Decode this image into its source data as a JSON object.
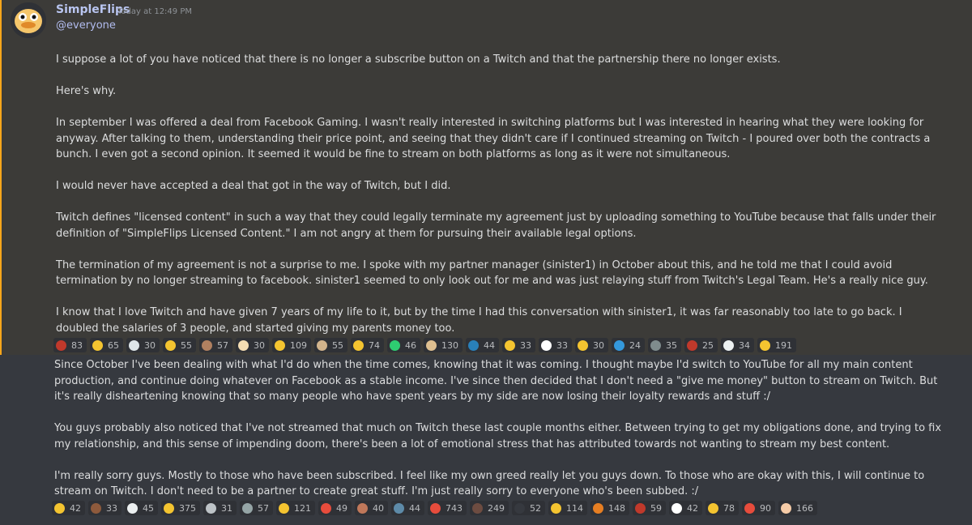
{
  "message": {
    "author": "SimpleFlips",
    "timestamp": "Today at 12:49 PM",
    "mention": "@everyone",
    "paragraphs_part1": [
      "I suppose a lot of you have noticed that there is no longer a subscribe button on a Twitch and that the partnership there no longer exists.",
      "Here's why.",
      "In september I was offered a deal from Facebook Gaming. I wasn't really interested in switching platforms but I was interested in hearing what they were looking for anyway. After talking to them, understanding their price point, and seeing that they didn't care if I continued streaming on Twitch - I poured over both the contracts a bunch. I even got a second opinion. It seemed it would be fine to stream on both platforms as long as it were not simultaneous.",
      "I would never have accepted a deal that got in the way of Twitch, but I did.",
      "Twitch defines \"licensed content\" in such a way that they could legally terminate my agreement just by uploading something to YouTube because that falls under their definition of \"SimpleFlips Licensed Content.\" I am not angry at them for pursuing their available legal options.",
      "The termination of my agreement is not a surprise to me. I spoke with my partner manager (sinister1) in October about this, and he told me that I could avoid termination by no longer streaming to facebook. sinister1 seemed to only look out for me and was just relaying stuff from Twitch's Legal Team. He's a really nice guy.",
      "I know that I love Twitch and have given 7 years of my life to it, but by the time I had this conversation with sinister1, it was far reasonably too late to go back. I doubled the salaries of 3 people, and started giving my parents money too."
    ],
    "paragraphs_part2": [
      "Since October I've been dealing with what I'd do when the time comes, knowing that it was coming. I thought maybe I'd switch to YouTube for all my main content production, and continue doing whatever on Facebook as a stable income. I've since then decided that I don't need a \"give me money\" button to stream on Twitch. But it's really disheartening knowing that so many people who have spent years by my side are now losing their loyalty rewards and stuff :/",
      "You guys probably also noticed that I've not streamed that much on Twitch these last couple months either. Between trying to get my obligations done, and trying to fix my relationship, and this sense of impending doom, there's been a lot of emotional stress that has attributed towards not wanting to stream my best content.",
      "I'm really sorry guys. Mostly to those who have been subscribed. I feel like my own greed really let you guys down. To those who are okay with this, I will continue to stream on Twitch. I don't need to be a partner to create great stuff. I'm just really sorry to everyone who's been subbed. :/"
    ]
  },
  "reactions_row1": [
    {
      "emoji": "emoji-1",
      "color": "#c0392b",
      "count": "83"
    },
    {
      "emoji": "thinking-icon",
      "color": "#f4c430",
      "count": "65"
    },
    {
      "emoji": "page-icon",
      "color": "#dfe6e9",
      "count": "30"
    },
    {
      "emoji": "flushed-icon",
      "color": "#f4c430",
      "count": "55"
    },
    {
      "emoji": "face-emote-icon",
      "color": "#b08060",
      "count": "57"
    },
    {
      "emoji": "blank-emote-icon",
      "color": "#f5deb3",
      "count": "30"
    },
    {
      "emoji": "thumbsup-icon",
      "color": "#f4c430",
      "count": "109"
    },
    {
      "emoji": "emote-icon",
      "color": "#d2b48c",
      "count": "55"
    },
    {
      "emoji": "relieved-icon",
      "color": "#f4c430",
      "count": "74"
    },
    {
      "emoji": "frog-icon",
      "color": "#2ecc71",
      "count": "46"
    },
    {
      "emoji": "emote2-icon",
      "color": "#e0c090",
      "count": "130"
    },
    {
      "emoji": "emote3-icon",
      "color": "#2980b9",
      "count": "44"
    },
    {
      "emoji": "facepalm-icon",
      "color": "#f4c430",
      "count": "33"
    },
    {
      "emoji": "finland-flag-icon",
      "color": "#ffffff",
      "count": "33"
    },
    {
      "emoji": "ear-icon",
      "color": "#f4c430",
      "count": "30"
    },
    {
      "emoji": "info-icon",
      "color": "#3498db",
      "count": "24"
    },
    {
      "emoji": "emote4-icon",
      "color": "#7f8c8d",
      "count": "35"
    },
    {
      "emoji": "emote5-icon",
      "color": "#c0392b",
      "count": "25"
    },
    {
      "emoji": "clown-icon",
      "color": "#ecf0f1",
      "count": "34"
    },
    {
      "emoji": "cry-icon",
      "color": "#f4c430",
      "count": "191"
    }
  ],
  "reactions_row2": [
    {
      "emoji": "laughing-icon",
      "color": "#f4c430",
      "count": "42"
    },
    {
      "emoji": "emote6-icon",
      "color": "#8e5a3c",
      "count": "33"
    },
    {
      "emoji": "eyes-icon",
      "color": "#ecf0f1",
      "count": "45"
    },
    {
      "emoji": "sad-icon",
      "color": "#f4c430",
      "count": "375"
    },
    {
      "emoji": "emote7-icon",
      "color": "#bdc3c7",
      "count": "31"
    },
    {
      "emoji": "emote8-icon",
      "color": "#95a5a6",
      "count": "57"
    },
    {
      "emoji": "ok-hand-icon",
      "color": "#f4c430",
      "count": "121"
    },
    {
      "emoji": "chart-up-icon",
      "color": "#e74c3c",
      "count": "49"
    },
    {
      "emoji": "emote9-icon",
      "color": "#c0785a",
      "count": "40"
    },
    {
      "emoji": "emote10-icon",
      "color": "#5d8aa8",
      "count": "44"
    },
    {
      "emoji": "heart-icon",
      "color": "#e74c3c",
      "count": "743"
    },
    {
      "emoji": "emote11-icon",
      "color": "#6d4c41",
      "count": "249"
    },
    {
      "emoji": "blank-icon",
      "color": "#36393f",
      "count": "52"
    },
    {
      "emoji": "worried-icon",
      "color": "#f4c430",
      "count": "114"
    },
    {
      "emoji": "emote12-icon",
      "color": "#e67e22",
      "count": "148"
    },
    {
      "emoji": "emote13-icon",
      "color": "#c0392b",
      "count": "59"
    },
    {
      "emoji": "finland-flag-icon",
      "color": "#ffffff",
      "count": "42"
    },
    {
      "emoji": "smirk-icon",
      "color": "#f4c430",
      "count": "78"
    },
    {
      "emoji": "broken-heart-icon",
      "color": "#e74c3c",
      "count": "90"
    },
    {
      "emoji": "thumbsup-light-icon",
      "color": "#f5cba7",
      "count": "166"
    }
  ]
}
